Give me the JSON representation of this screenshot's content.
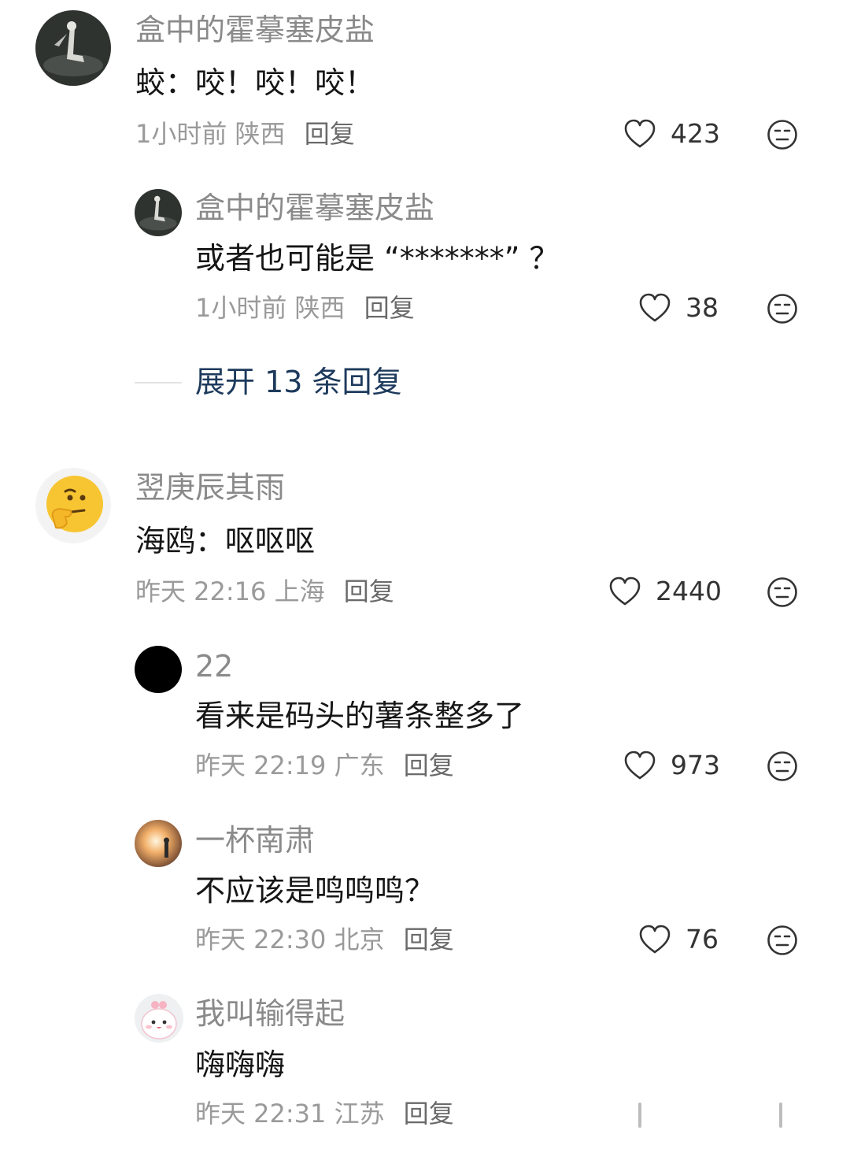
{
  "comments": [
    {
      "name": "盒中的霍摹塞皮盐",
      "text": "蛟：咬！咬！咬！",
      "time": "1小时前",
      "location": "陕西",
      "reply": "回复",
      "likes": "423"
    },
    {
      "name": "盒中的霍摹塞皮盐",
      "text": "或者也可能是 “*******” ？",
      "time": "1小时前",
      "location": "陕西",
      "reply": "回复",
      "likes": "38"
    },
    {
      "name": "翌庚辰其雨",
      "text": "海鸥：呕呕呕",
      "time": "昨天 22:16",
      "location": "上海",
      "reply": "回复",
      "likes": "2440"
    },
    {
      "name": "22",
      "text": "看来是码头的薯条整多了",
      "time": "昨天 22:19",
      "location": "广东",
      "reply": "回复",
      "likes": "973"
    },
    {
      "name": "一杯南肃",
      "text": "不应该是鸣鸣鸣？",
      "time": "昨天 22:30",
      "location": "北京",
      "reply": "回复",
      "likes": "76"
    },
    {
      "name": "我叫输得起",
      "text": "嗨嗨嗨",
      "time": "昨天 22:31",
      "location": "江苏",
      "reply": "回复",
      "likes": ""
    }
  ],
  "expand_replies": "展开 13 条回复",
  "icons": {
    "like": "heart-icon",
    "dislike": "dislike-face-icon"
  },
  "colors": {
    "name": "#8a8a8a",
    "text": "#161616",
    "meta": "#9a9a9a",
    "expand": "#1d3a5c"
  }
}
